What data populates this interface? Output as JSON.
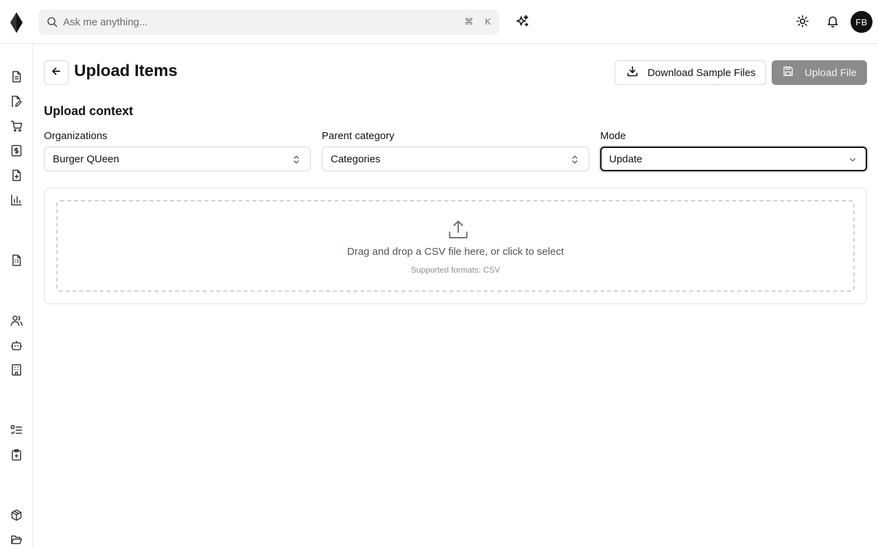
{
  "search": {
    "placeholder": "Ask me anything...",
    "shortcut_cmd": "⌘",
    "shortcut_key": "K"
  },
  "user": {
    "initials": "FB"
  },
  "page": {
    "title": "Upload Items",
    "download_label": "Download Sample Files",
    "upload_label": "Upload File"
  },
  "context": {
    "title": "Upload context",
    "fields": [
      {
        "label": "Organizations",
        "value": "Burger QUeen"
      },
      {
        "label": "Parent category",
        "value": "Categories"
      },
      {
        "label": "Mode",
        "value": "Update"
      }
    ]
  },
  "dropzone": {
    "text": "Drag and drop a CSV file here, or click to select",
    "formats": "Supported formats: CSV"
  },
  "icons": {
    "logo": "diamond-logo-icon",
    "search": "search-icon",
    "ai": "sparkles-icon",
    "theme": "sun-icon",
    "notifications": "bell-icon",
    "sidebar": [
      "file-text-icon",
      "file-edit-icon",
      "cart-icon",
      "receipt-dollar-icon",
      "file-plus-icon",
      "bar-chart-icon",
      "file-list-icon",
      "users-icon",
      "bot-icon",
      "building-icon",
      "checklist-icon",
      "clipboard-plus-icon",
      "package-icon",
      "folder-open-icon"
    ]
  },
  "colors": {
    "accent": "#111111",
    "disabled_button": "#8b8b8e",
    "muted_text": "#6b6b72"
  }
}
